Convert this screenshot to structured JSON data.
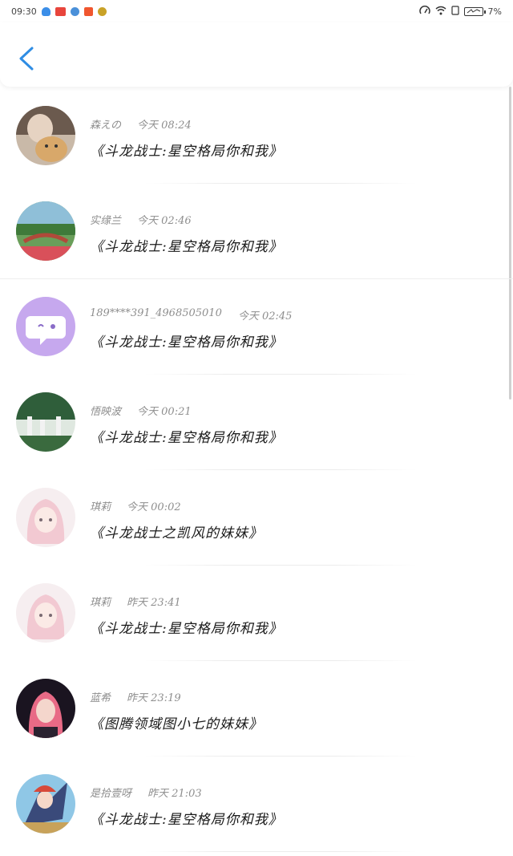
{
  "status_bar": {
    "time": "09:30",
    "battery": "7%",
    "app_icons": [
      "#e8453c",
      "#f0562e",
      "#4a90d9",
      "#f7b500"
    ]
  },
  "header": {
    "back_icon": "chevron-left-icon",
    "accent": "#2f8de4"
  },
  "items": [
    {
      "user": "森えの",
      "time": "今天 08:24",
      "title": "《斗龙战士:星空格局你和我》",
      "avatar": "cat-photo"
    },
    {
      "user": "实缘兰",
      "time": "今天 02:46",
      "title": "《斗龙战士:星空格局你和我》",
      "avatar": "garden-bridge"
    },
    {
      "user": "189****391_4968505010",
      "time": "今天 02:45",
      "title": "《斗龙战士:星空格局你和我》",
      "avatar": "chat-bubble"
    },
    {
      "user": "悟映波",
      "time": "今天 00:21",
      "title": "《斗龙战士:星空格局你和我》",
      "avatar": "forest"
    },
    {
      "user": "琪莉",
      "time": "今天 00:02",
      "title": "《斗龙战士之凯风的妹妹》",
      "avatar": "anime-girl"
    },
    {
      "user": "琪莉",
      "time": "昨天 23:41",
      "title": "《斗龙战士:星空格局你和我》",
      "avatar": "anime-girl"
    },
    {
      "user": "蓝希",
      "time": "昨天 23:19",
      "title": "《图腾领域图小七的妹妹》",
      "avatar": "pink-hair-girl"
    },
    {
      "user": "是拾壹呀",
      "time": "昨天 21:03",
      "title": "《斗龙战士:星空格局你和我》",
      "avatar": "anime-warrior"
    }
  ]
}
